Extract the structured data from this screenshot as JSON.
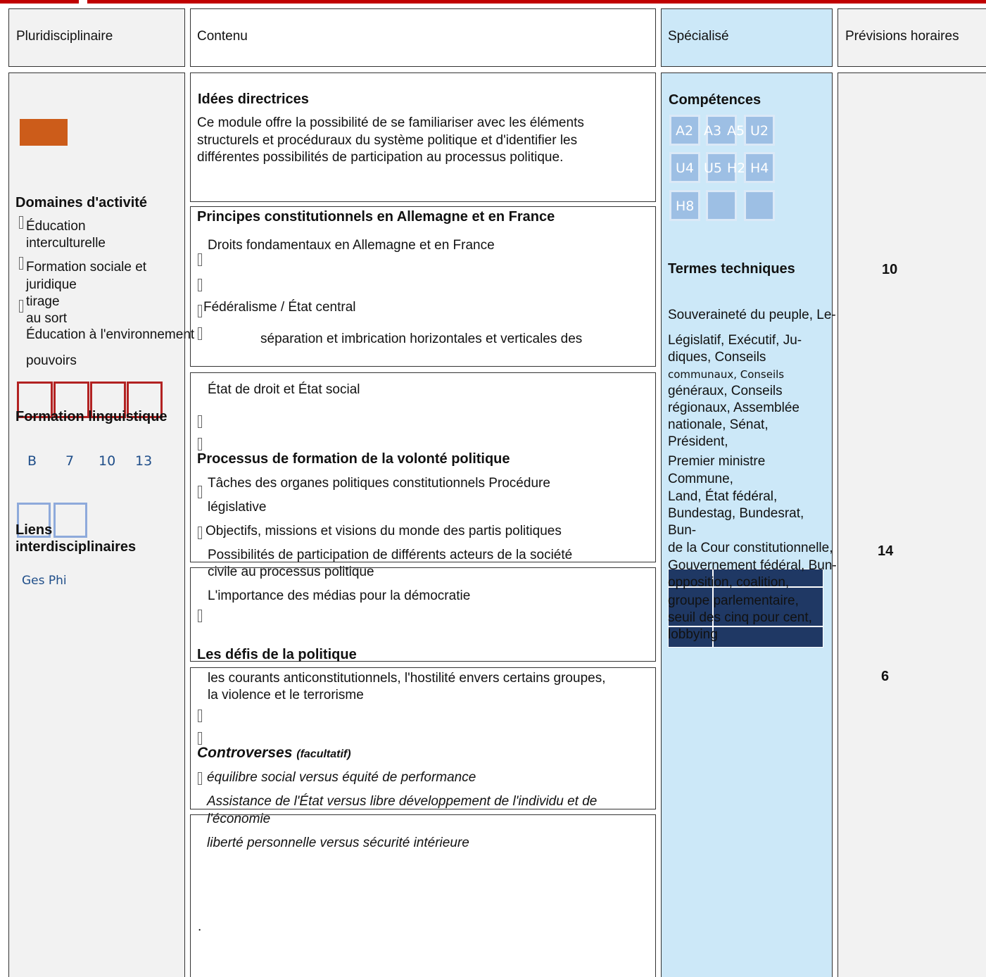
{
  "colors": {
    "topbar": "#c00000",
    "specialized_bg": "#cce8f8",
    "orange": "#cc5c1a",
    "dark_blue": "#1f3864",
    "light_blue_sq": "#9dbfe4",
    "red_sq": "#b22222"
  },
  "header": {
    "pluri": "Pluridisciplinaire",
    "contenu": "Contenu",
    "specialise": "Spécialisé",
    "previsions": "Prévisions horaires"
  },
  "pluri": {
    "domaines_title": "Domaines d'activité",
    "dom1a": "Éducation",
    "dom1b": "interculturelle",
    "dom2a": "Formation sociale et",
    "dom2b": "juridique",
    "dom3a": "tirage",
    "dom3b": "au sort",
    "dom4a": "Éducation à l'environnement",
    "dom4b": "pouvoirs",
    "formation_title": "Formation linguistique",
    "levels": [
      "B",
      "7",
      "10",
      "13"
    ],
    "liens_a": "Liens",
    "liens_b": "interdisciplinaires",
    "liens_items": "Ges Phi"
  },
  "contenu": {
    "idees_title": "Idées directrices",
    "idees_l1": "Ce module offre la possibilité de se familiariser avec les éléments",
    "idees_l2": "structurels et procéduraux du système politique et d'identifier les",
    "idees_l3": "différentes possibilités de participation au processus politique.",
    "principes_title": "Principes constitutionnels en Allemagne et en France",
    "droits": "Droits fondamentaux en Allemagne et en France",
    "federalisme": "Fédéralisme / État central",
    "separation": "séparation et imbrication horizontales et verticales des",
    "etat_droit": "État de droit et État social",
    "processus_title": "Processus de formation de la volonté politique",
    "taches_l1": "Tâches des organes politiques constitutionnels Procédure",
    "taches_l2": "législative",
    "objectifs": "Objectifs, missions et visions du monde des partis politiques",
    "possibilites_l1": "Possibilités de participation de différents acteurs de la société",
    "possibilites_l2": "civile au processus politique",
    "medias": "L'importance des médias pour la démocratie",
    "defis_title": "Les défis de la politique",
    "courants_l1": "les courants anticonstitutionnels, l'hostilité envers certains groupes,",
    "courants_l2": "la violence et le terrorisme",
    "controverses_title": "Controverses",
    "controverses_sub": "(facultatif)",
    "equilibre": "équilibre social versus équité de performance",
    "assistance_l1": "Assistance de l'État versus libre développement de l'individu et de",
    "assistance_l2": "l'économie",
    "liberte": "liberté personnelle versus sécurité intérieure",
    "dot": "."
  },
  "specialise": {
    "competences_title": "Compétences",
    "competences": [
      "A2",
      "A3",
      "A5",
      "U2",
      "U4",
      "U5",
      "H2",
      "H4",
      "H8"
    ],
    "termes_title": "Termes techniques",
    "terms": [
      "Souveraineté du peuple, Le-",
      "Législatif, Exécutif, Ju-",
      "diques, Conseils",
      "communaux, Conseils",
      "généraux, Conseils",
      "régionaux, Assemblée",
      "nationale, Sénat,",
      "Président,",
      "Premier ministre",
      "Commune,",
      "Land, État fédéral,",
      "Bundestag, Bundesrat,",
      "Bun-",
      "de la Cour constitutionnelle,",
      "Gouvernement fédéral, Bun-",
      "opposition, coalition,",
      "groupe parlementaire,",
      "seuil des cinq pour cent,",
      "lobbying"
    ]
  },
  "hours": [
    "10",
    "14",
    "6"
  ]
}
